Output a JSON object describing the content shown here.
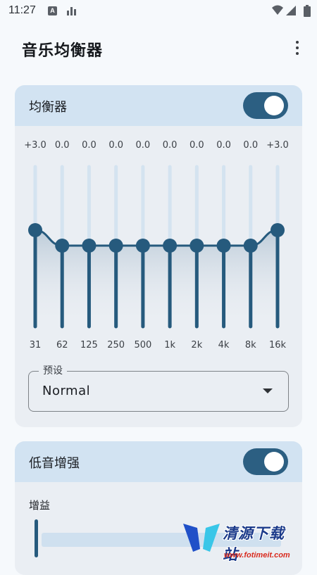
{
  "status_bar": {
    "time": "11:27",
    "a_badge": "A"
  },
  "app_bar": {
    "title": "音乐均衡器"
  },
  "equalizer": {
    "title": "均衡器",
    "enabled": true,
    "band_values": [
      "+3.0",
      "0.0",
      "0.0",
      "0.0",
      "0.0",
      "0.0",
      "0.0",
      "0.0",
      "0.0",
      "+3.0"
    ],
    "band_levels_db": [
      3.0,
      0.0,
      0.0,
      0.0,
      0.0,
      0.0,
      0.0,
      0.0,
      0.0,
      3.0
    ],
    "frequencies": [
      "31",
      "62",
      "125",
      "250",
      "500",
      "1k",
      "2k",
      "4k",
      "8k",
      "16k"
    ],
    "preset": {
      "label": "预设",
      "value": "Normal"
    }
  },
  "bass_boost": {
    "title": "低音增强",
    "enabled": true,
    "gain_label": "增益",
    "gain_level": 0.0
  },
  "watermark": {
    "title": "清源下载站",
    "url": "www.fotimeit.com"
  },
  "colors": {
    "accent": "#2c5f82",
    "card_header": "#d2e3f2",
    "card_bg": "#eaeef3",
    "page_bg": "#f6f9fc"
  }
}
